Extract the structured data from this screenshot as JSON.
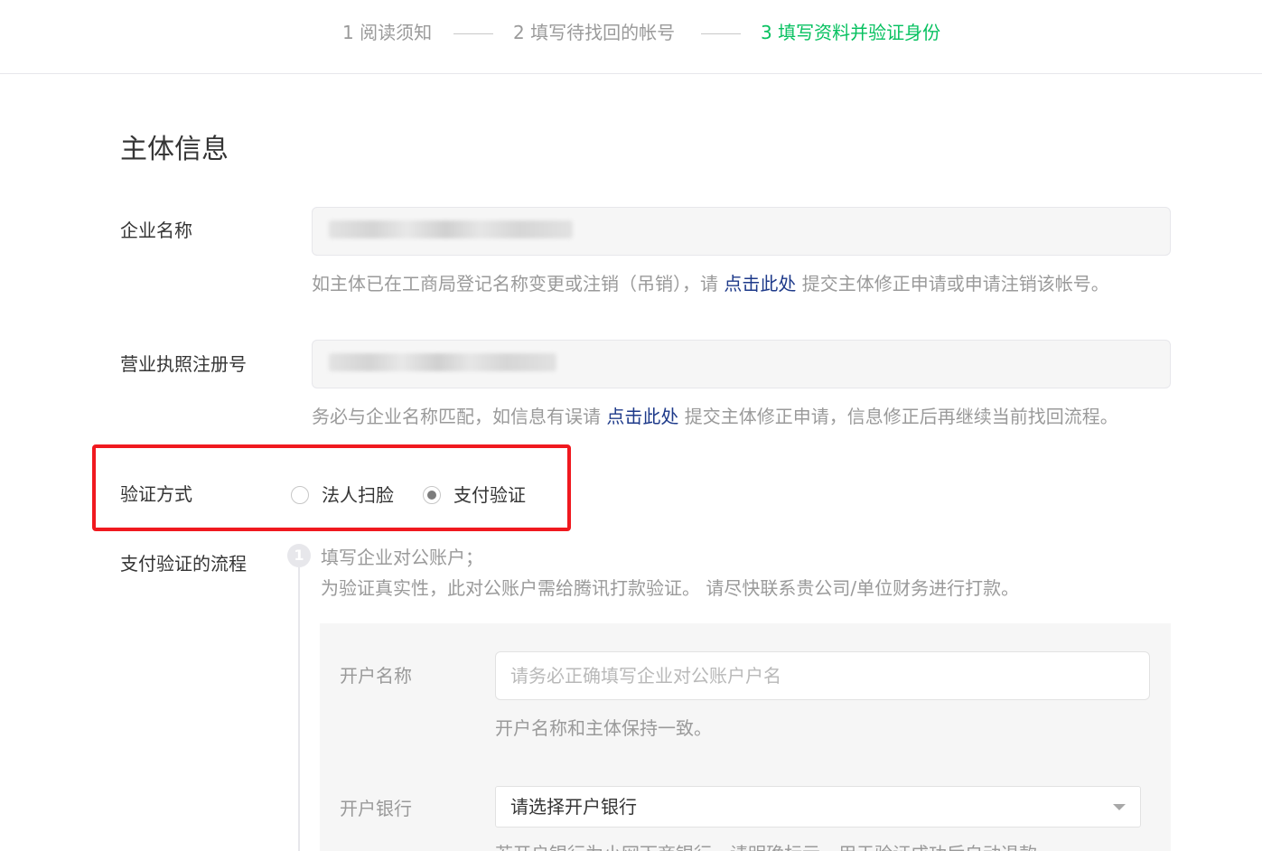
{
  "steps": [
    {
      "label": "1 阅读须知",
      "state": "done"
    },
    {
      "label": "2 填写待找回的帐号",
      "state": "done"
    },
    {
      "label": "3 填写资料并验证身份",
      "state": "active"
    }
  ],
  "colors": {
    "active_step": "#07c160",
    "highlight": "#f0191f",
    "link": "#1e3a8a"
  },
  "section_title": "主体信息",
  "company_name": {
    "label": "企业名称",
    "hint_before": "如主体已在工商局登记名称变更或注销（吊销），请 ",
    "hint_link": "点击此处",
    "hint_after": " 提交主体修正申请或申请注销该帐号。"
  },
  "license_number": {
    "label": "营业执照注册号",
    "hint_before": "务必与企业名称匹配，如信息有误请 ",
    "hint_link": "点击此处",
    "hint_after": " 提交主体修正申请，信息修正后再继续当前找回流程。"
  },
  "verify_method": {
    "label": "验证方式",
    "options": [
      {
        "label": "法人扫脸",
        "checked": false
      },
      {
        "label": "支付验证",
        "checked": true
      }
    ]
  },
  "payment_flow": {
    "label": "支付验证的流程",
    "step_number": "1",
    "step_title": "填写企业对公账户；",
    "step_desc": "为验证真实性，此对公账户需给腾讯打款验证。 请尽快联系贵公司/单位财务进行打款。",
    "account_name": {
      "label": "开户名称",
      "placeholder": "请务必正确填写企业对公账户户名",
      "hint": "开户名称和主体保持一致。"
    },
    "bank": {
      "label": "开户银行",
      "selected": "请选择开户银行"
    },
    "partial_text": "若开户银行为小网下商银行，请明确标示。用于验证成功后自动退款"
  }
}
